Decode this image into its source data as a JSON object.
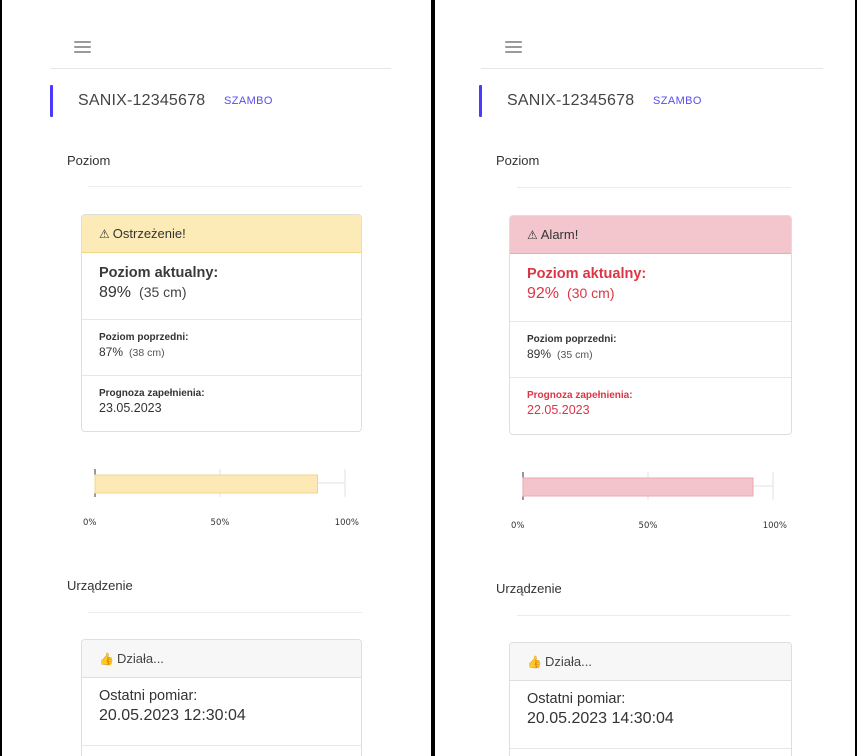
{
  "panels": [
    {
      "device": {
        "name": "SANIX-12345678",
        "type": "SZAMBO"
      },
      "level_section": {
        "title": "Poziom"
      },
      "status_card": {
        "status": "warning",
        "header_icon": "warning-triangle-icon",
        "header_text": "Ostrzeżenie!",
        "current_label": "Poziom aktualny:",
        "current_percent": "89%",
        "current_cm": "(35 cm)",
        "previous_label": "Poziom poprzedni:",
        "previous_percent": "87%",
        "previous_cm": "(38 cm)",
        "forecast_label": "Prognoza zapełnienia:",
        "forecast_value": "23.05.2023"
      },
      "chart_data": {
        "type": "bar",
        "orientation": "horizontal",
        "values": [
          89
        ],
        "xlim": [
          0,
          100
        ],
        "x_ticks": [
          "0%",
          "50%",
          "100%"
        ],
        "color": "#fde9b5",
        "border_color": "#f2d48a"
      },
      "device_section": {
        "title": "Urządzenie"
      },
      "device_card": {
        "header_icon": "thumbs-up-icon",
        "header_text": "Działa...",
        "last_label": "Ostatni pomiar:",
        "last_value": "20.05.2023 12:30:04"
      }
    },
    {
      "device": {
        "name": "SANIX-12345678",
        "type": "SZAMBO"
      },
      "level_section": {
        "title": "Poziom"
      },
      "status_card": {
        "status": "alarm",
        "header_icon": "warning-triangle-icon",
        "header_text": "Alarm!",
        "current_label": "Poziom aktualny:",
        "current_percent": "92%",
        "current_cm": "(30 cm)",
        "previous_label": "Poziom poprzedni:",
        "previous_percent": "89%",
        "previous_cm": "(35 cm)",
        "forecast_label": "Prognoza zapełnienia:",
        "forecast_value": "22.05.2023"
      },
      "chart_data": {
        "type": "bar",
        "orientation": "horizontal",
        "values": [
          92
        ],
        "xlim": [
          0,
          100
        ],
        "x_ticks": [
          "0%",
          "50%",
          "100%"
        ],
        "color": "#f4c4cc",
        "border_color": "#eaa7b3"
      },
      "device_section": {
        "title": "Urządzenie"
      },
      "device_card": {
        "header_icon": "thumbs-up-icon",
        "header_text": "Działa...",
        "last_label": "Ostatni pomiar:",
        "last_value": "20.05.2023 14:30:04"
      }
    }
  ],
  "colors": {
    "accent": "#4a3aff",
    "warning_bg": "#fdebb7",
    "alarm_bg": "#f3c6cd",
    "alarm_text": "#dc3545"
  }
}
